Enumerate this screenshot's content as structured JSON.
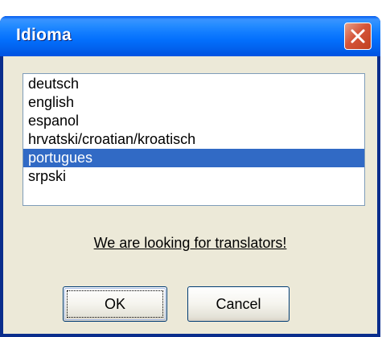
{
  "window": {
    "title": "Idioma"
  },
  "languages": {
    "items": [
      {
        "label": "deutsch",
        "selected": false
      },
      {
        "label": "english",
        "selected": false
      },
      {
        "label": "espanol",
        "selected": false
      },
      {
        "label": "hrvatski/croatian/kroatisch",
        "selected": false
      },
      {
        "label": "portugues",
        "selected": true
      },
      {
        "label": "srpski",
        "selected": false
      }
    ],
    "selected_value": "portugues"
  },
  "link": {
    "text": "We are looking for translators!"
  },
  "buttons": {
    "ok_label": "OK",
    "cancel_label": "Cancel"
  },
  "colors": {
    "titlebar": "#0054E3",
    "dialog_background": "#ECE9D8",
    "selection": "#316AC5",
    "close_button": "#D5553A"
  },
  "icons": {
    "close": "close-icon"
  }
}
